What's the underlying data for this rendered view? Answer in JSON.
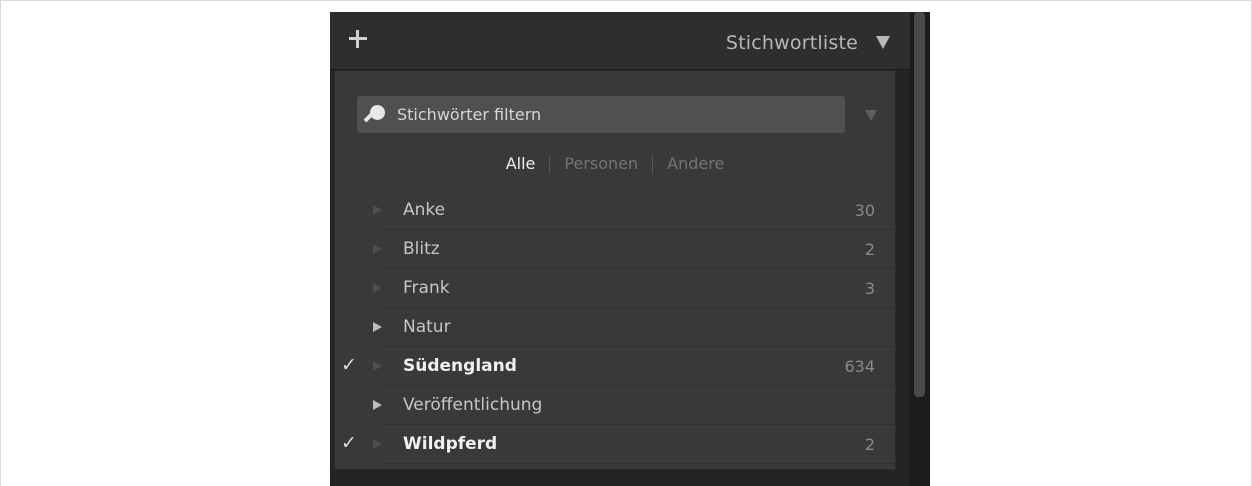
{
  "panel": {
    "title": "Stichwortliste",
    "add_icon": "plus-icon",
    "collapse_icon": "triangle-down-icon"
  },
  "filter": {
    "placeholder": "Stichwörter filtern",
    "icon": "search-icon"
  },
  "tabs": [
    {
      "label": "Alle",
      "active": true
    },
    {
      "label": "Personen",
      "active": false
    },
    {
      "label": "Andere",
      "active": false
    }
  ],
  "keywords": [
    {
      "label": "Anke",
      "count": "30",
      "checked": false,
      "expandable": false
    },
    {
      "label": "Blitz",
      "count": "2",
      "checked": false,
      "expandable": false
    },
    {
      "label": "Frank",
      "count": "3",
      "checked": false,
      "expandable": false
    },
    {
      "label": "Natur",
      "count": "",
      "checked": false,
      "expandable": true
    },
    {
      "label": "Südengland",
      "count": "634",
      "checked": true,
      "expandable": false
    },
    {
      "label": "Veröffentlichung",
      "count": "",
      "checked": false,
      "expandable": true
    },
    {
      "label": "Wildpferd",
      "count": "2",
      "checked": true,
      "expandable": false
    }
  ],
  "check_glyph": "✓",
  "colors": {
    "panel_bg": "#393939",
    "header_bg": "#2e2e2e",
    "text_active": "#eeeeee",
    "text_muted": "#747474"
  }
}
